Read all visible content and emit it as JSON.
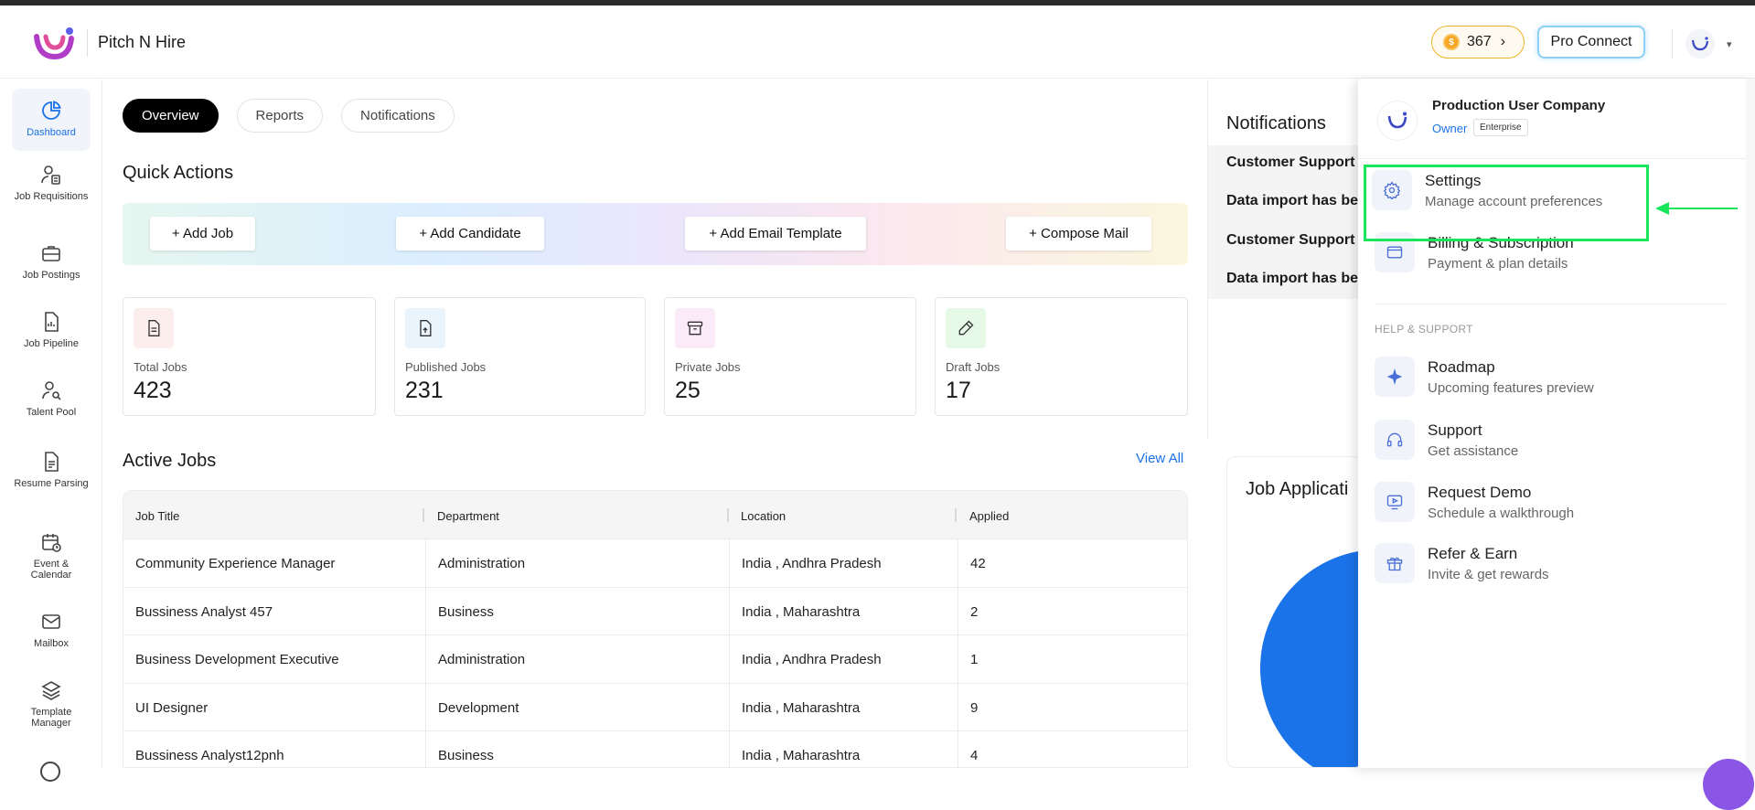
{
  "header": {
    "brand": "Pitch N Hire",
    "coins": "367",
    "pro_connect": "Pro Connect"
  },
  "sidebar": {
    "items": [
      {
        "label": "Dashboard",
        "icon": "pie-chart-icon"
      },
      {
        "label": "Job Requisitions",
        "icon": "user-list-icon"
      },
      {
        "label": "Job Postings",
        "icon": "briefcase-icon"
      },
      {
        "label": "Job Pipeline",
        "icon": "file-chart-icon"
      },
      {
        "label": "Talent Pool",
        "icon": "user-search-icon"
      },
      {
        "label": "Resume Parsing",
        "icon": "document-icon"
      },
      {
        "label": "Event & Calendar",
        "icon": "calendar-icon"
      },
      {
        "label": "Mailbox",
        "icon": "mail-icon"
      },
      {
        "label": "Template Manager",
        "icon": "layers-icon"
      }
    ]
  },
  "tabs": [
    "Overview",
    "Reports",
    "Notifications"
  ],
  "quick_actions": {
    "title": "Quick Actions",
    "buttons": [
      "+ Add Job",
      "+ Add Candidate",
      "+ Add Email Template",
      "+ Compose Mail"
    ]
  },
  "stats": [
    {
      "label": "Total Jobs",
      "value": "423",
      "color": "#fdeeee",
      "icon": "file-text-icon"
    },
    {
      "label": "Published Jobs",
      "value": "231",
      "color": "#eaf4fd",
      "icon": "file-upload-icon"
    },
    {
      "label": "Private Jobs",
      "value": "25",
      "color": "#fbeaf8",
      "icon": "archive-icon"
    },
    {
      "label": "Draft Jobs",
      "value": "17",
      "color": "#e6f9e6",
      "icon": "pencil-icon"
    }
  ],
  "active_jobs": {
    "title": "Active Jobs",
    "view_all": "View All",
    "columns": [
      "Job Title",
      "Department",
      "Location",
      "Applied"
    ],
    "rows": [
      [
        "Community Experience Manager",
        "Administration",
        "India , Andhra Pradesh",
        "42"
      ],
      [
        "Bussiness Analyst 457",
        "Business",
        "India , Maharashtra",
        "2"
      ],
      [
        "Business Development Executive",
        "Administration",
        "India , Andhra Pradesh",
        "1"
      ],
      [
        "UI Designer",
        "Development",
        "India , Maharashtra",
        "9"
      ],
      [
        "Bussiness Analyst12pnh",
        "Business",
        "India , Maharashtra",
        "4"
      ]
    ]
  },
  "notifications": {
    "title": "Notifications",
    "items": [
      "Customer Support",
      "Data import has be",
      "Customer Support",
      "Data import has be"
    ]
  },
  "chart": {
    "title": "Job Applicati",
    "color": "#1a73e8"
  },
  "dropdown": {
    "company": "Production User Company",
    "role": "Owner",
    "plan": "Enterprise",
    "items": [
      {
        "title": "Settings",
        "subtitle": "Manage account preferences",
        "icon": "gear-icon"
      },
      {
        "title": "Billing & Subscription",
        "subtitle": "Payment & plan details",
        "icon": "wallet-icon"
      }
    ],
    "section_label": "HELP & SUPPORT",
    "support_items": [
      {
        "title": "Roadmap",
        "subtitle": "Upcoming features preview",
        "icon": "sparkle-icon"
      },
      {
        "title": "Support",
        "subtitle": "Get assistance",
        "icon": "headset-icon"
      },
      {
        "title": "Request Demo",
        "subtitle": "Schedule a walkthrough",
        "icon": "video-icon"
      },
      {
        "title": "Refer & Earn",
        "subtitle": "Invite & get rewards",
        "icon": "gift-icon"
      }
    ]
  },
  "accent_colors": {
    "primary": "#1a73e8",
    "annotation": "#19e65a"
  }
}
